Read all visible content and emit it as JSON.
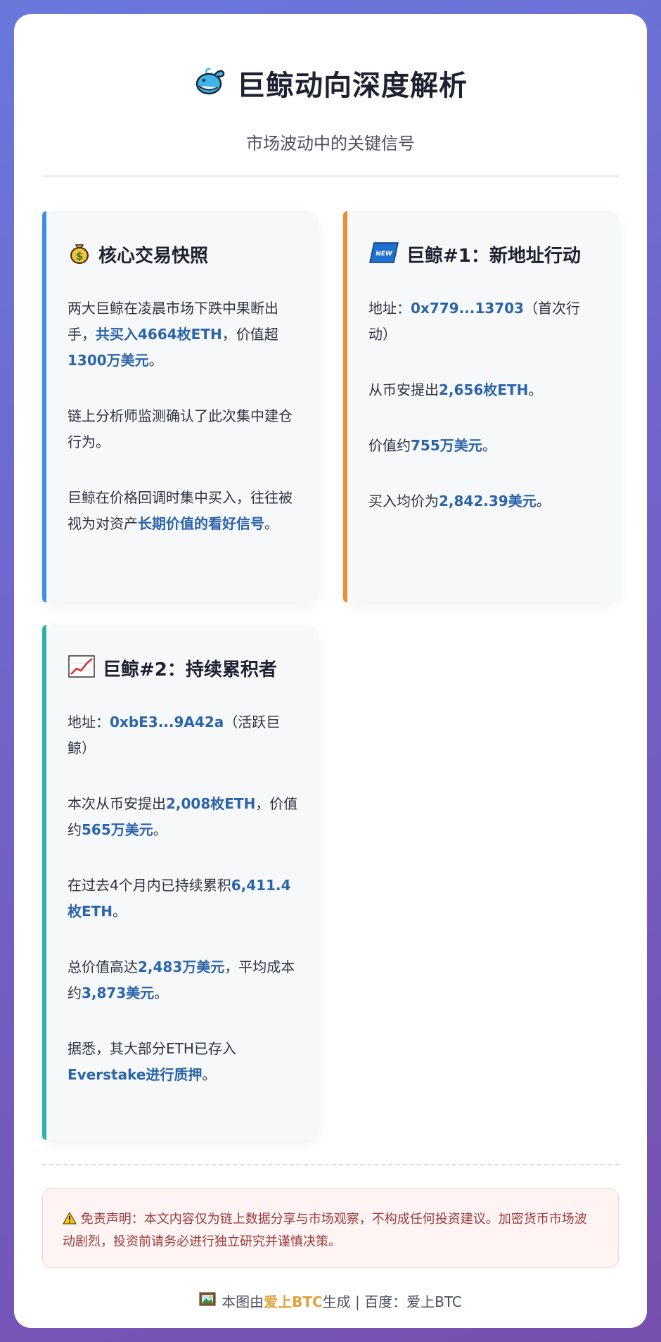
{
  "header": {
    "title": "巨鲸动向深度解析",
    "subtitle": "市场波动中的关键信号",
    "title_icon": "whale-icon"
  },
  "panels": [
    {
      "icon": "money-bag-icon",
      "title": "核心交易快照",
      "paragraphs": [
        [
          {
            "t": "两大巨鲸在凌晨市场下跌中果断出手，"
          },
          {
            "t": "共买入4664枚ETH",
            "hl": true
          },
          {
            "t": "，价值超"
          },
          {
            "t": "1300万美元",
            "hl": true
          },
          {
            "t": "。"
          }
        ],
        [
          {
            "t": "链上分析师监测确认了此次集中建仓行为。"
          }
        ],
        [
          {
            "t": "巨鲸在价格回调时集中买入，往往被视为对资产"
          },
          {
            "t": "长期价值的看好信号",
            "hl": true
          },
          {
            "t": "。"
          }
        ]
      ]
    },
    {
      "icon": "new-badge-icon",
      "title": "巨鲸#1：新地址行动",
      "paragraphs": [
        [
          {
            "t": "地址："
          },
          {
            "t": "0x779...13703",
            "hl": true
          },
          {
            "t": "（首次行动）"
          }
        ],
        [
          {
            "t": "从币安提出"
          },
          {
            "t": "2,656枚ETH",
            "hl": true
          },
          {
            "t": "。"
          }
        ],
        [
          {
            "t": "价值约"
          },
          {
            "t": "755万美元",
            "hl": true
          },
          {
            "t": "。"
          }
        ],
        [
          {
            "t": "买入均价为"
          },
          {
            "t": "2,842.39美元",
            "hl": true
          },
          {
            "t": "。"
          }
        ]
      ]
    },
    {
      "icon": "chart-increasing-icon",
      "title": "巨鲸#2：持续累积者",
      "paragraphs": [
        [
          {
            "t": "地址："
          },
          {
            "t": "0xbE3...9A42a",
            "hl": true
          },
          {
            "t": "（活跃巨鲸）"
          }
        ],
        [
          {
            "t": "本次从币安提出"
          },
          {
            "t": "2,008枚ETH",
            "hl": true
          },
          {
            "t": "，价值约"
          },
          {
            "t": "565万美元",
            "hl": true
          },
          {
            "t": "。"
          }
        ],
        [
          {
            "t": "在过去4个月内已持续累积"
          },
          {
            "t": "6,411.4枚ETH",
            "hl": true
          },
          {
            "t": "。"
          }
        ],
        [
          {
            "t": "总价值高达"
          },
          {
            "t": "2,483万美元",
            "hl": true
          },
          {
            "t": "，平均成本约"
          },
          {
            "t": "3,873美元",
            "hl": true
          },
          {
            "t": "。"
          }
        ],
        [
          {
            "t": "据悉，其大部分ETH已存入"
          },
          {
            "t": "Everstake进行质押",
            "hl": true
          },
          {
            "t": "。"
          }
        ]
      ]
    }
  ],
  "disclaimer": {
    "icon": "warning-icon",
    "text": "免责声明：本文内容仅为链上数据分享与市场观察，不构成任何投资建议。加密货币市场波动剧烈，投资前请务必进行独立研究并谨慎决策。"
  },
  "footer": {
    "icon": "picture-icon",
    "prefix": "本图由",
    "brand": "爱上BTC",
    "suffix": "生成 | 百度：爱上BTC"
  },
  "colors": {
    "accent_blue": "#3f8fe0",
    "accent_orange": "#ee8b34",
    "accent_teal": "#2fb1a7",
    "highlight": "#2b64a8",
    "brand": "#e2a23a"
  }
}
